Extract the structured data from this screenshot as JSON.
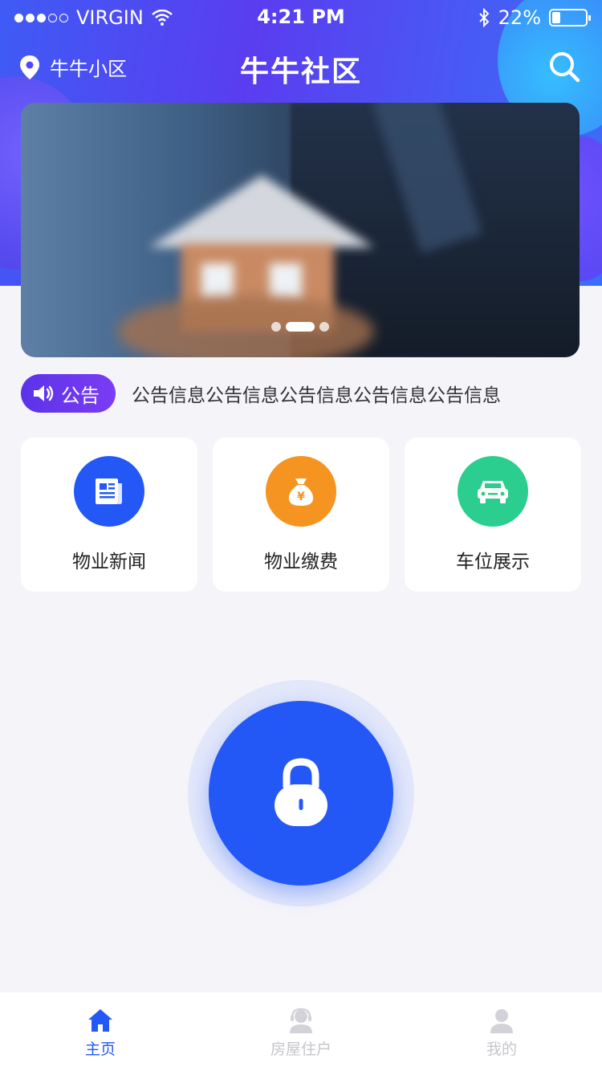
{
  "status_bar": {
    "carrier": "VIRGIN",
    "time": "4:21 PM",
    "battery": "22%",
    "battery_level": 0.22
  },
  "nav": {
    "location": "牛牛小区",
    "title": "牛牛社区",
    "icons": {
      "location": "location-pin-icon",
      "search": "search-icon"
    }
  },
  "banner": {
    "slide_count": 3,
    "active_slide": 1
  },
  "notice": {
    "label": "公告",
    "text": "公告信息公告信息公告信息公告信息公告信息",
    "icon": "speaker-icon"
  },
  "services": [
    {
      "label": "物业新闻",
      "icon": "newspaper-icon",
      "color": "#2358f7"
    },
    {
      "label": "物业缴费",
      "icon": "money-bag-icon",
      "color": "#f59421"
    },
    {
      "label": "车位展示",
      "icon": "car-icon",
      "color": "#2bce8e"
    }
  ],
  "unlock": {
    "icon": "lock-icon",
    "color": "#2358f7"
  },
  "tabs": [
    {
      "label": "主页",
      "icon": "home-icon",
      "active": true
    },
    {
      "label": "房屋住户",
      "icon": "resident-icon",
      "active": false
    },
    {
      "label": "我的",
      "icon": "user-icon",
      "active": false
    }
  ],
  "colors": {
    "primary": "#2358f7",
    "notice_pill": "#6a38ef",
    "tab_inactive": "#c6c6cc",
    "background": "#f4f4f9"
  }
}
